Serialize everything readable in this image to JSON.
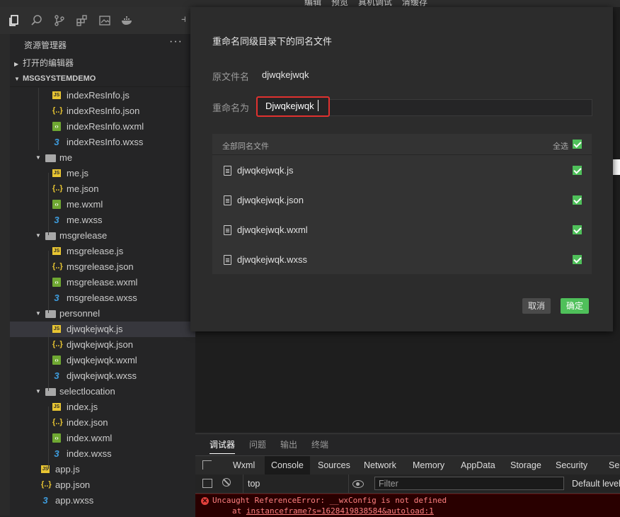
{
  "top_menu": [
    "编辑",
    "预览",
    "真机调试",
    "清缓存"
  ],
  "sidebar": {
    "title": "资源管理器",
    "more": "···",
    "open_editors": "打开的编辑器",
    "project": "MSGSYSTEMDEMO",
    "tree": [
      {
        "label": "indexResInfo.js",
        "type": "js"
      },
      {
        "label": "indexResInfo.json",
        "type": "json"
      },
      {
        "label": "indexResInfo.wxml",
        "type": "wxml"
      },
      {
        "label": "indexResInfo.wxss",
        "type": "wxss"
      },
      {
        "label": "me",
        "type": "folder"
      },
      {
        "label": "me.js",
        "type": "js"
      },
      {
        "label": "me.json",
        "type": "json"
      },
      {
        "label": "me.wxml",
        "type": "wxml"
      },
      {
        "label": "me.wxss",
        "type": "wxss"
      },
      {
        "label": "msgrelease",
        "type": "folder"
      },
      {
        "label": "msgrelease.js",
        "type": "js"
      },
      {
        "label": "msgrelease.json",
        "type": "json"
      },
      {
        "label": "msgrelease.wxml",
        "type": "wxml"
      },
      {
        "label": "msgrelease.wxss",
        "type": "wxss"
      },
      {
        "label": "personnel",
        "type": "folder"
      },
      {
        "label": "djwqkejwqk.js",
        "type": "js",
        "selected": true
      },
      {
        "label": "djwqkejwqk.json",
        "type": "json"
      },
      {
        "label": "djwqkejwqk.wxml",
        "type": "wxml"
      },
      {
        "label": "djwqkejwqk.wxss",
        "type": "wxss"
      },
      {
        "label": "selectlocation",
        "type": "folder"
      },
      {
        "label": "index.js",
        "type": "js"
      },
      {
        "label": "index.json",
        "type": "json"
      },
      {
        "label": "index.wxml",
        "type": "wxml"
      },
      {
        "label": "index.wxss",
        "type": "wxss"
      },
      {
        "label": "app.js",
        "type": "js"
      },
      {
        "label": "app.json",
        "type": "json"
      },
      {
        "label": "app.wxss",
        "type": "wxss"
      }
    ]
  },
  "dialog": {
    "title": "重命名同级目录下的同名文件",
    "original_label": "原文件名",
    "original_value": "djwqkejwqk",
    "rename_label": "重命名为",
    "rename_value": "Djwqkejwqk",
    "list_header": "全部同名文件",
    "select_all": "全选",
    "files": [
      "djwqkejwqk.js",
      "djwqkejwqk.json",
      "djwqkejwqk.wxml",
      "djwqkejwqk.wxss"
    ],
    "cancel": "取消",
    "ok": "确定"
  },
  "debug": {
    "tabs": [
      "调试器",
      "问题",
      "输出",
      "终端"
    ],
    "devtools_tabs": [
      "Wxml",
      "Console",
      "Sources",
      "Network",
      "Memory",
      "AppData",
      "Storage",
      "Security",
      "Sen"
    ],
    "active_devtools_tab": "Console",
    "context": "top",
    "filter_placeholder": "Filter",
    "levels": "Default levels",
    "error_message": "Uncaught ReferenceError: __wxConfig is not defined",
    "error_at": "at",
    "error_link": "instanceframe?s=1628419838584&autoload:1"
  },
  "colors": {
    "accent": "#4fc05a",
    "highlight": "#e0312f",
    "error": "#ff8080"
  }
}
